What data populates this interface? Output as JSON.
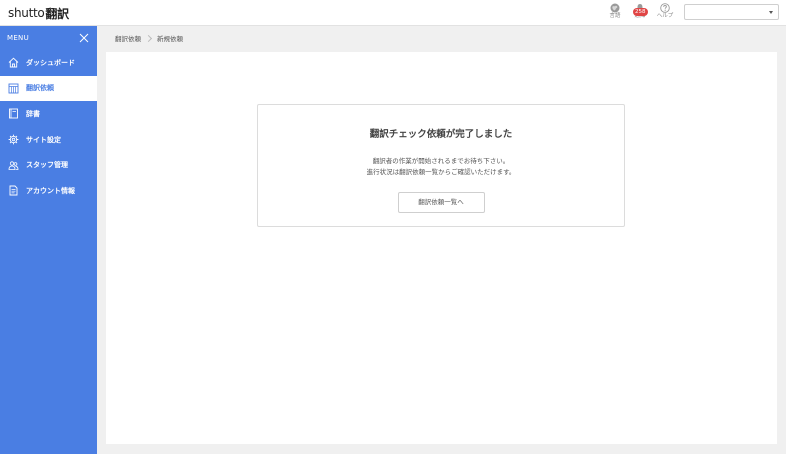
{
  "header": {
    "logo_brand": "shutto",
    "logo_jp": "翻訳",
    "language_label": "言語",
    "notifications_label": "通知",
    "notifications_count": "258",
    "help_label": "ヘルプ",
    "site_select_value": ""
  },
  "sidebar": {
    "menu_label": "MENU",
    "items": [
      {
        "label": "ダッシュボード",
        "icon": "home-icon"
      },
      {
        "label": "翻訳依頼",
        "icon": "calendar-grid-icon"
      },
      {
        "label": "辞書",
        "icon": "book-icon"
      },
      {
        "label": "サイト設定",
        "icon": "gear-icon"
      },
      {
        "label": "スタッフ管理",
        "icon": "staff-icon"
      },
      {
        "label": "アカウント情報",
        "icon": "document-icon"
      }
    ],
    "active_index": 1
  },
  "breadcrumb": [
    "翻訳依頼",
    "新規依頼"
  ],
  "card": {
    "title": "翻訳チェック依頼が完了しました",
    "message_line1": "翻訳者の作業が開始されるまでお待ち下さい。",
    "message_line2": "進行状況は翻訳依頼一覧からご確認いただけます。",
    "button_label": "翻訳依頼一覧へ"
  },
  "colors": {
    "accent": "#4a7ee3",
    "badge": "#e04545"
  }
}
